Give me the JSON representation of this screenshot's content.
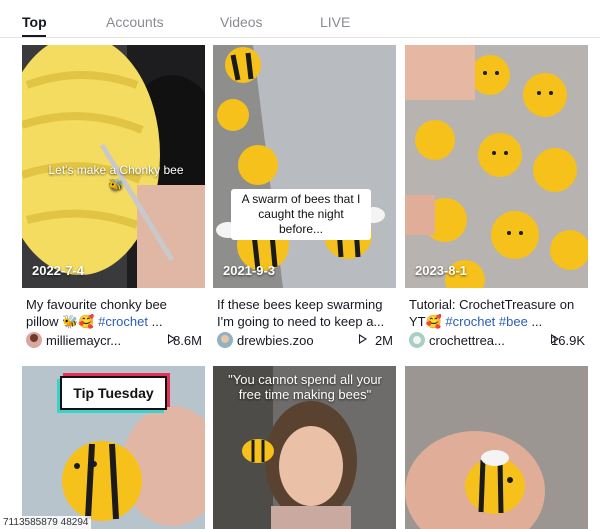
{
  "tabs": [
    {
      "label": "Top",
      "active": true
    },
    {
      "label": "Accounts",
      "active": false
    },
    {
      "label": "Videos",
      "active": false
    },
    {
      "label": "LIVE",
      "active": false
    }
  ],
  "cards": [
    {
      "date": "2022-7-4",
      "overlay": "Let's make a Chonky bee 🐝",
      "desc_text": "My favourite chonky bee pillow 🐝🥰 ",
      "desc_tag": "#crochet",
      "desc_more": " ...",
      "username": "milliemaycr...",
      "views": "8.6M"
    },
    {
      "date": "2021-9-3",
      "overlay": "A swarm of bees that I caught the night before...",
      "desc_text": "If these bees keep swarming I'm going to need to keep a...",
      "desc_tag": "",
      "desc_more": "",
      "username": "drewbies.zoo",
      "views": "2M"
    },
    {
      "date": "2023-8-1",
      "overlay": "",
      "desc_text": "Tutorial: CrochetTreasure on YT🥰 ",
      "desc_tag": "#crochet #bee",
      "desc_more": " ...",
      "username": "crochettrea...",
      "views": "16.9K"
    },
    {
      "date": "",
      "overlay": "Tip Tuesday"
    },
    {
      "date": "",
      "overlay": "\"You cannot spend all your free time making bees\""
    },
    {
      "date": "",
      "overlay": ""
    }
  ],
  "video_id": "7113585879 48294",
  "colors": {
    "accent": "#fe2c55",
    "tag": "#2b5db9",
    "bee_yellow": "#f6c11b",
    "bee_black": "#1b1b1b"
  }
}
